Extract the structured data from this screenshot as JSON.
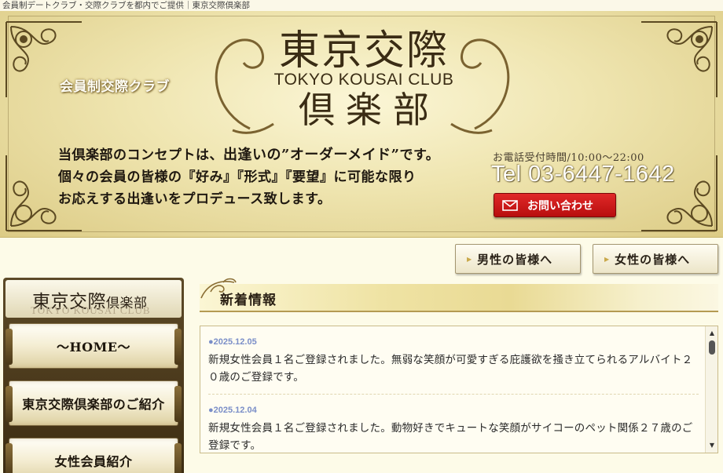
{
  "topline": "会員制デートクラブ・交際クラブを都内でご提供｜東京交際倶楽部",
  "header": {
    "member_label": "会員制交際クラブ",
    "logo_main": "東京交際",
    "logo_en": "TOKYO KOUSAI CLUB",
    "logo_sub": "倶楽部",
    "concept_l1_a": "当倶楽部のコンセプトは、",
    "concept_l1_b": "出逢いの”オーダーメイド”",
    "concept_l1_c": "です。",
    "concept_l2": "個々の会員の皆様の『好み』『形式』『要望』に可能な限り",
    "concept_l3": "お応えする出逢いをプロデュース致します。",
    "phone_hours": "お電話受付時間/10:00～22:00",
    "phone_number": "Tel 03-6447-1642",
    "contact_label": "お問い合わせ"
  },
  "gender_nav": {
    "men_label": "男性の皆様へ",
    "women_label": "女性の皆様へ"
  },
  "sidebar": {
    "logo_jp": "東京交際",
    "logo_jp_small": "倶楽部",
    "logo_en": "TOKYO KOUSAI CLUB",
    "items": [
      {
        "label": "～HOME～"
      },
      {
        "label": "東京交際倶楽部のご紹介"
      },
      {
        "label": "女性会員紹介"
      }
    ]
  },
  "news": {
    "title": "新着情報",
    "items": [
      {
        "date": "●2025.12.05",
        "text": "新規女性会員１名ご登録されました。無弱な笑顔が可愛すぎる庇護欲を掻き立てられるアルバイト２０歳のご登録です。"
      },
      {
        "date": "●2025.12.04",
        "text": "新規女性会員１名ご登録されました。動物好きでキュートな笑顔がサイコーのペット関係２７歳のご登録です。"
      }
    ]
  },
  "colors": {
    "header_gold": "#e9da94",
    "contact_red": "#d01c1c",
    "date_blue": "#7a8ec8"
  },
  "icons": [
    "corner-ornament-icon",
    "mail-icon",
    "arrow-icon",
    "scroll-up-icon",
    "scroll-down-icon"
  ]
}
